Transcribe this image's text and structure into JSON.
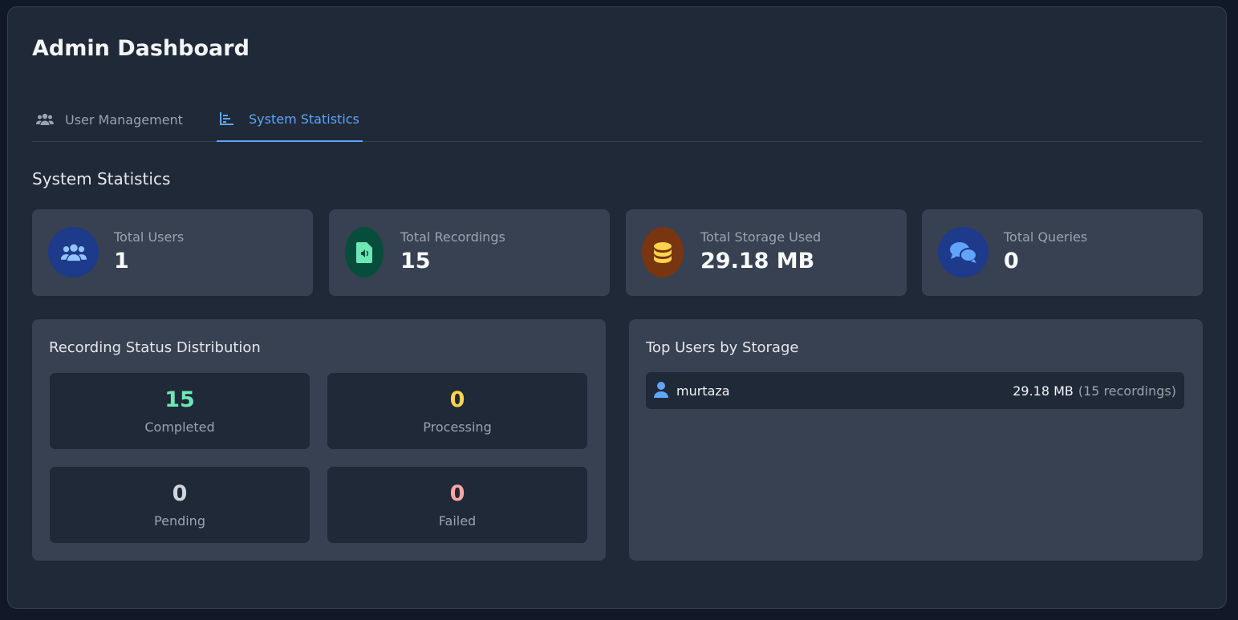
{
  "page_title": "Admin Dashboard",
  "tabs": [
    {
      "label": "User Management",
      "icon": "users-icon",
      "active": false
    },
    {
      "label": "System Statistics",
      "icon": "bar-chart-icon",
      "active": true
    }
  ],
  "section_title": "System Statistics",
  "stats": [
    {
      "label": "Total Users",
      "value": "1",
      "icon": "users-icon",
      "color": "#1e3a8a",
      "icon_color": "#93c5fd"
    },
    {
      "label": "Total Recordings",
      "value": "15",
      "icon": "audio-file-icon",
      "color": "#064e3b",
      "icon_color": "#6ee7b7"
    },
    {
      "label": "Total Storage Used",
      "value": "29.18 MB",
      "icon": "database-icon",
      "color": "#78350f",
      "icon_color": "#fcd34d"
    },
    {
      "label": "Total Queries",
      "value": "0",
      "icon": "comments-icon",
      "color": "#1e3a8a",
      "icon_color": "#60a5fa"
    }
  ],
  "recording_status": {
    "title": "Recording Status Distribution",
    "items": [
      {
        "label": "Completed",
        "value": "15",
        "color": "#6ee7b7"
      },
      {
        "label": "Processing",
        "value": "0",
        "color": "#fcd34d"
      },
      {
        "label": "Pending",
        "value": "0",
        "color": "#d1d5db"
      },
      {
        "label": "Failed",
        "value": "0",
        "color": "#fca5a5"
      }
    ]
  },
  "top_users": {
    "title": "Top Users by Storage",
    "users": [
      {
        "name": "murtaza",
        "storage": "29.18 MB",
        "recordings": "(15 recordings)"
      }
    ]
  }
}
